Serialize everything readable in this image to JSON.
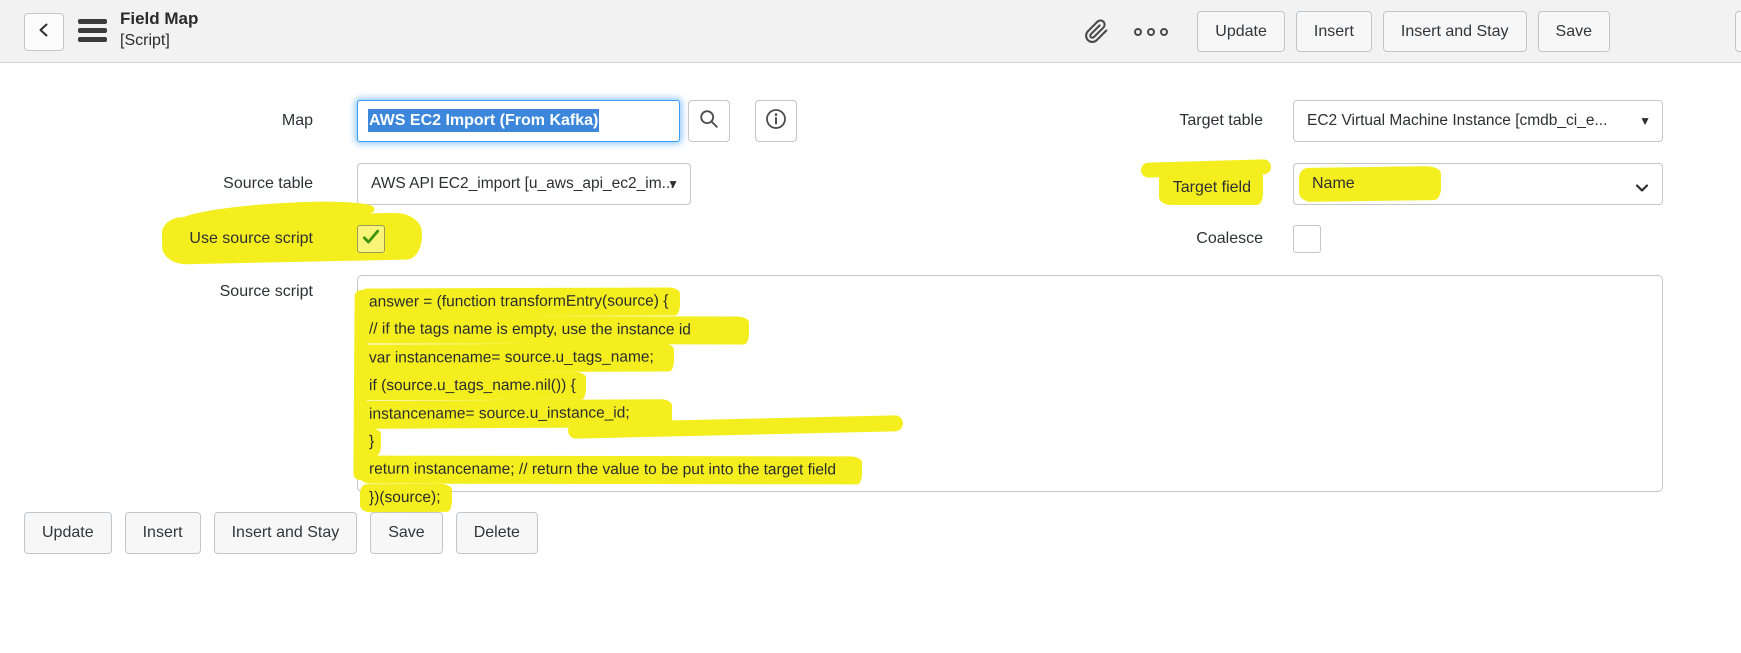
{
  "header": {
    "title": "Field Map",
    "subtitle": "[Script]",
    "actions": [
      "Update",
      "Insert",
      "Insert and Stay",
      "Save"
    ]
  },
  "form": {
    "map": {
      "label": "Map",
      "value": "AWS EC2 Import (From Kafka)"
    },
    "target_table": {
      "label": "Target table",
      "value": "EC2 Virtual Machine Instance [cmdb_ci_e..."
    },
    "source_table": {
      "label": "Source table",
      "value": "AWS API EC2_import [u_aws_api_ec2_im..."
    },
    "target_field": {
      "label": "Target field",
      "value": "Name"
    },
    "use_source_script": {
      "label": "Use source script",
      "checked": true
    },
    "coalesce": {
      "label": "Coalesce",
      "checked": false
    },
    "source_script": {
      "label": "Source script",
      "lines": [
        "answer = (function transformEntry(source) {",
        "// if the tags name is empty, use the instance id",
        "var instancename= source.u_tags_name;",
        "if (source.u_tags_name.nil()) {",
        "instancename= source.u_instance_id;",
        "}",
        "return instancename; // return the value to be put into the target field",
        "})(source);"
      ]
    }
  },
  "footer": {
    "actions": [
      "Update",
      "Insert",
      "Insert and Stay",
      "Save",
      "Delete"
    ]
  },
  "icons": {
    "dropdown_triangle": "▼"
  },
  "colors": {
    "annotation_highlight": "#f5ee1e",
    "text_selection": "#3c87db",
    "focus_ring": "#3b9df5",
    "checkbox_check": "#3f9410",
    "header_background": "#f2f2f2"
  }
}
